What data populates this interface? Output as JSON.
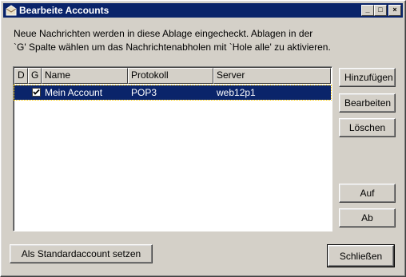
{
  "window": {
    "title": "Bearbeite Accounts",
    "icon": "mail-folder-icon"
  },
  "titlebar_buttons": {
    "minimize": "_",
    "maximize": "□",
    "close": "×"
  },
  "description": {
    "line1": "Neue Nachrichten werden in diese Ablage eingecheckt. Ablagen in der",
    "line2": "`G' Spalte wählen um das Nachrichtenabholen mit `Hole alle' zu aktivieren."
  },
  "table": {
    "columns": [
      "D",
      "G",
      "Name",
      "Protokoll",
      "Server"
    ],
    "rows": [
      {
        "d": "",
        "g_checked": true,
        "name": "Mein Account",
        "protokoll": "POP3",
        "server": "web12p1",
        "selected": true
      }
    ]
  },
  "buttons": {
    "add": "Hinzufügen",
    "edit": "Bearbeiten",
    "delete": "Löschen",
    "up": "Auf",
    "down": "Ab",
    "set_default": "Als Standardaccount setzen",
    "close": "Schließen"
  },
  "colors": {
    "selection": "#0a246a",
    "titlebar": "#0a246a",
    "face": "#d4d0c8"
  }
}
